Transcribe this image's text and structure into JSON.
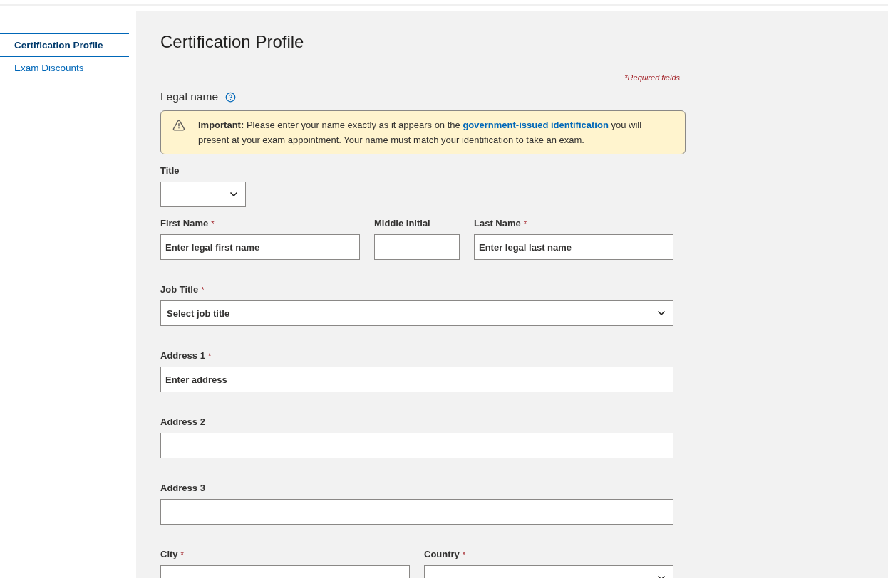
{
  "sidebar": {
    "items": [
      {
        "label": "Certification Profile",
        "selected": true
      },
      {
        "label": "Exam Discounts",
        "selected": false
      }
    ]
  },
  "page": {
    "title": "Certification Profile",
    "required_note": "*Required fields",
    "required_marker": "*"
  },
  "legal_name": {
    "label": "Legal name"
  },
  "alert": {
    "before": "**Important:** Please enter your name exactly as it appears on the",
    "link": "government-issued identification",
    "after": "you will present at your exam appointment. Your name must match your identification to take an exam."
  },
  "rows": [
    [
      {
        "label": "Title",
        "kind": "select",
        "required": false
      }
    ],
    [
      {
        "label": "First Name",
        "kind": "text",
        "required": true,
        "placeholder": "Enter legal first name"
      },
      {
        "label": "Middle Initial",
        "kind": "text",
        "required": false
      },
      {
        "label": "Last Name",
        "kind": "text",
        "required": true,
        "placeholder": "Enter legal last name"
      }
    ],
    [
      {
        "label": "Job Title",
        "kind": "select",
        "required": true,
        "value": "Select job title"
      }
    ],
    [
      {
        "label": "Address 1",
        "kind": "text",
        "required": true,
        "placeholder": "Enter address"
      }
    ],
    [
      {
        "label": "Address 2",
        "kind": "text",
        "required": false
      }
    ],
    [
      {
        "label": "Address 3",
        "kind": "text",
        "required": false
      }
    ],
    [
      {
        "label": "City",
        "kind": "text",
        "required": true
      },
      {
        "label": "Country",
        "kind": "select",
        "required": true
      }
    ]
  ]
}
